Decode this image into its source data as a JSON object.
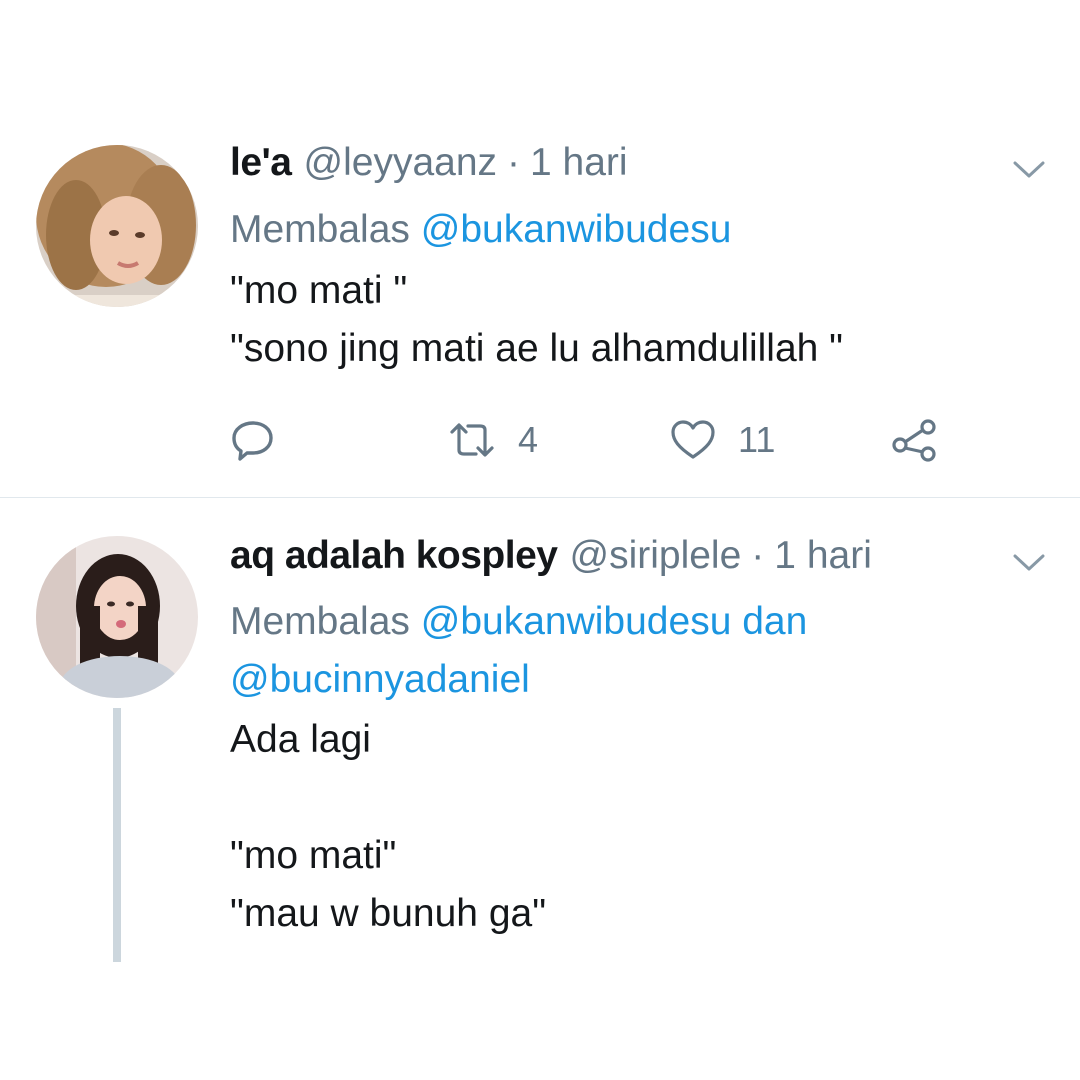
{
  "colors": {
    "text_primary": "#14171a",
    "text_secondary": "#657786",
    "mention": "#1b95e0",
    "divider": "#e1e8ed",
    "thread_line": "#ccd6dd"
  },
  "tweets": [
    {
      "display_name": "le'a",
      "handle": "@leyyaanz",
      "separator": "·",
      "time": "1 hari",
      "reply_prefix": "Membalas",
      "reply_mentions": [
        "@bukanwibudesu"
      ],
      "reply_joiner": "",
      "text": "\"mo mati \"\n\"sono jing mati ae lu alhamdulillah \"",
      "actions": {
        "reply_icon": "reply-icon",
        "retweet_icon": "retweet-icon",
        "retweet_count": "4",
        "like_icon": "heart-icon",
        "like_count": "11",
        "share_icon": "share-icon"
      }
    },
    {
      "display_name": "aq adalah kospley",
      "handle": "@siriplele",
      "separator": "·",
      "time": "1 hari",
      "reply_prefix": "Membalas",
      "reply_mentions": [
        "@bukanwibudesu",
        "@bucinnyadaniel"
      ],
      "reply_joiner": "dan",
      "text": "Ada lagi\n\n\"mo mati\"\n\"mau w bunuh ga\""
    }
  ]
}
